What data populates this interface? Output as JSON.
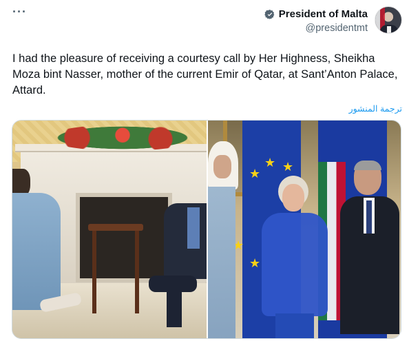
{
  "header": {
    "more_label": "···",
    "display_name": "President of Malta",
    "handle": "@presidentmt",
    "verified_color": "#536471"
  },
  "tweet": {
    "text": "I had the pleasure of receiving a courtesy call by Her Highness, Sheikha Moza bint Nasser, mother of the current Emir of Qatar, at Sant’Anton Palace, Attard.",
    "translate_label": "ترجمة المنشور"
  },
  "media": {
    "photos": [
      "photo-left",
      "photo-right"
    ]
  },
  "colors": {
    "text": "#0f1419",
    "muted": "#536471",
    "link": "#1d9bf0",
    "border": "#cfd9de"
  }
}
